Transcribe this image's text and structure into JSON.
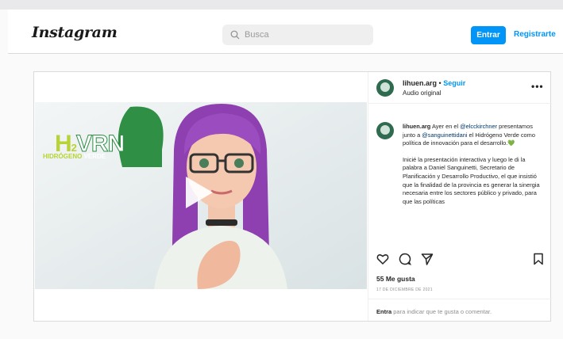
{
  "header": {
    "logo": "Instagram",
    "search_placeholder": "Busca",
    "login_label": "Entrar",
    "signup_label": "Registrarte"
  },
  "post": {
    "username": "lihuen.arg",
    "dot": "•",
    "follow_label": "Seguir",
    "audio_label": "Audio original",
    "more_icon": "more-icon",
    "video": {
      "logo_h": "H",
      "logo_2": "2",
      "logo_vrn": "VRN",
      "logo_sub_left": "HIDRÓGENO",
      "logo_sub_right": "VERDE"
    },
    "caption": {
      "username": "lihuen.arg",
      "text_1": " Ayer en el ",
      "mention_1": "@elcckirchner",
      "text_2": " presentamos junto a ",
      "mention_2": "@sanguinettidani",
      "text_3": " el Hidrógeno Verde como política de innovación para el desarrollo.",
      "heart": "💚",
      "paragraph_2": "Inicié la presentación interactiva y luego le di la palabra a Daniel Sanguinetti, Secretario de Planificación y Desarrollo Productivo, el que insistió que la finalidad de la provincia es generar la sinergia necesaria entre los sectores público y privado, para que las políticas"
    },
    "likes": "55 Me gusta",
    "date": "17 DE DICIEMBRE DE 2021",
    "comment_prompt_link": "Entra",
    "comment_prompt_text": " para indicar que te gusta o comentar."
  },
  "colors": {
    "accent": "#0095f6",
    "brand_green": "#2a9d4a",
    "hair_purple": "#8e3fb0"
  }
}
